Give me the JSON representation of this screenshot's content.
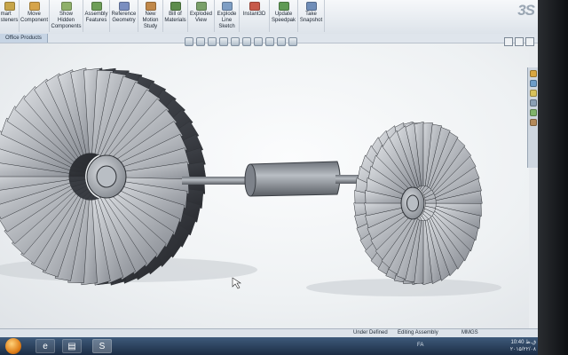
{
  "ribbon": {
    "items": [
      {
        "label": "mart\nsteners",
        "icon": "smart-fasteners-icon",
        "color": "#c7a54a"
      },
      {
        "label": "Move\nComponent",
        "icon": "move-component-icon",
        "color": "#d6a44a"
      },
      {
        "label": "Show\nHidden\nComponents",
        "icon": "show-hidden-icon",
        "color": "#8fb06a"
      },
      {
        "label": "Assembly\nFeatures",
        "icon": "assembly-features-icon",
        "color": "#6e9e58"
      },
      {
        "label": "Reference\nGeometry",
        "icon": "reference-geometry-icon",
        "color": "#7a8ec0"
      },
      {
        "label": "New\nMotion\nStudy",
        "icon": "motion-study-icon",
        "color": "#c0884a"
      },
      {
        "label": "Bill of\nMaterials",
        "icon": "bill-of-materials-icon",
        "color": "#5d8c4c"
      },
      {
        "label": "Exploded\nView",
        "icon": "exploded-view-icon",
        "color": "#7aa06a"
      },
      {
        "label": "Explode\nLine\nSketch",
        "icon": "explode-line-sketch-icon",
        "color": "#7e9ec4"
      },
      {
        "label": "Instant3D",
        "icon": "instant3d-icon",
        "color": "#c75a4a"
      },
      {
        "label": "Update\nSpeedpak",
        "icon": "speedpak-icon",
        "color": "#5f9a55"
      },
      {
        "label": "Take\nSnapshot",
        "icon": "snapshot-icon",
        "color": "#6f8db8"
      }
    ],
    "logo": "3S"
  },
  "tab": {
    "label": "Office Products"
  },
  "status": {
    "under_defined": "Under Defined",
    "editing": "Editing Assembly",
    "units": "MMGS"
  },
  "taskbar": {
    "language": "FA",
    "time": "10:40 ق.ظ",
    "date": "۲۰۱۵/۲۲/۰۸"
  },
  "colors": {
    "blade_light": "#c9ccd1",
    "blade_dark": "#3a3d44",
    "shaft": "#8a8f96"
  }
}
